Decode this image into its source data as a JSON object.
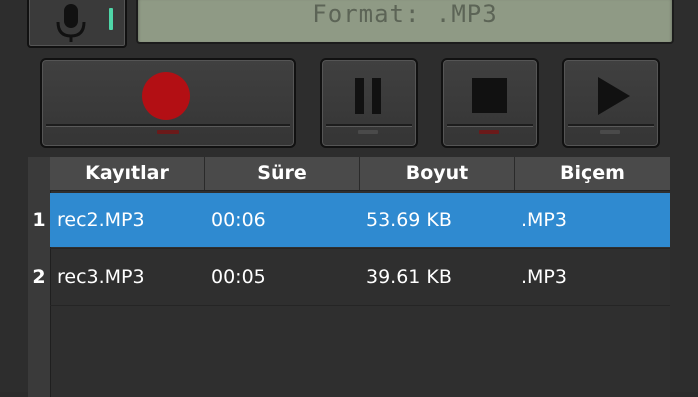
{
  "recorder": {
    "display_text": "Format: .MP3",
    "level_color": "#4fd6a8"
  },
  "buttons": {
    "record_color": "#b30f14"
  },
  "table": {
    "headers": [
      "Kayıtlar",
      "Süre",
      "Boyut",
      "Biçem"
    ],
    "rows": [
      {
        "index": "1",
        "name": "rec2.MP3",
        "duration": "00:06",
        "size": "53.69 KB",
        "format": ".MP3",
        "selected": true
      },
      {
        "index": "2",
        "name": "rec3.MP3",
        "duration": "00:05",
        "size": "39.61 KB",
        "format": ".MP3",
        "selected": false
      }
    ],
    "selection_color": "#2f8ad0"
  }
}
